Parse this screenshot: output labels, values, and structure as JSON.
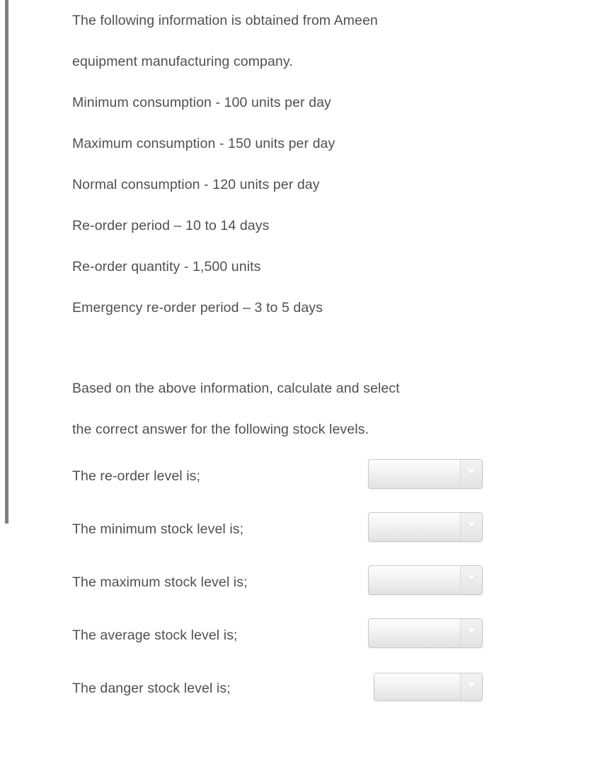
{
  "scrollbar": {
    "name": "vertical-scrollbar"
  },
  "question": {
    "intro_lines": [
      "The following information is obtained from Ameen",
      "equipment manufacturing company."
    ],
    "facts": [
      "Minimum consumption - 100 units per day",
      "Maximum consumption - 150 units per day",
      "Normal consumption - 120 units per day",
      "Re-order period – 10 to 14 days",
      "Re-order quantity - 1,500 units",
      "Emergency re-order period – 3 to 5 days"
    ],
    "instruction_lines": [
      "Based on the above information, calculate and select",
      "the correct answer for the following stock levels."
    ],
    "items": [
      {
        "label": "The re-order level is;",
        "selected": "",
        "placeholder": ""
      },
      {
        "label": "The minimum stock level is;",
        "selected": "",
        "placeholder": ""
      },
      {
        "label": "The maximum stock level is;",
        "selected": "",
        "placeholder": ""
      },
      {
        "label": "The average stock level is;",
        "selected": "",
        "placeholder": ""
      },
      {
        "label": "The danger stock level is;",
        "selected": "",
        "placeholder": ""
      }
    ]
  },
  "icons": {
    "caret": "chevron-down-icon"
  },
  "colors": {
    "text": "#4f5052",
    "page_background": "#ffffff",
    "scrollbar_thumb": "#818181",
    "select_border": "#c9c9c9"
  }
}
